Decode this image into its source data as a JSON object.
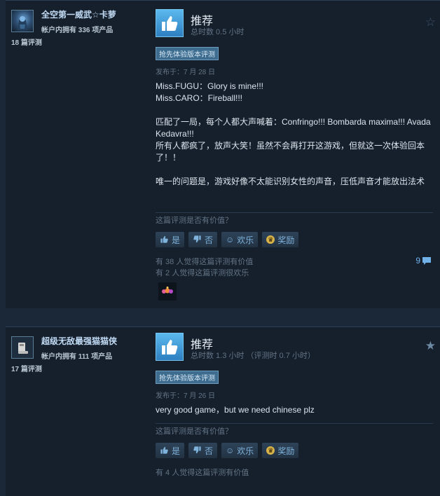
{
  "reviews": [
    {
      "author": {
        "name": "全空第一威武☆卡萝",
        "products": "帐户内拥有 336 项产品",
        "reviews": "18 篇评测"
      },
      "recommendation": "推荐",
      "playtime": "总时数 0.5 小时",
      "early_access_badge": "抢先体验版本评测",
      "posted": "发布于：7 月 28 日",
      "body_lines": [
        "Miss.FUGU：Glory is mine!!!",
        "Miss.CARO：Fireball!!!",
        "",
        "匹配了一局，每个人都大声喊着：Confringo!!! Bombarda maxima!!! Avada Kedavra!!!",
        "所有人都疯了，放声大笑！虽然不会再打开这游戏，但就这一次体验回本了！！",
        "",
        "唯一的问题是，游戏好像不太能识别女性的声音，压低声音才能放出法术"
      ],
      "helpful_question": "这篇评测是否有价值？",
      "buttons": {
        "yes": "是",
        "no": "否",
        "funny": "欢乐",
        "award": "奖励"
      },
      "helpful_count": "有 38 人觉得这篇评测有价值",
      "funny_count": "有 2 人觉得这篇评测很欢乐",
      "comment_count": "9"
    },
    {
      "author": {
        "name": "超级无敌最强猫猫侠",
        "products": "帐户内拥有 111 项产品",
        "reviews": "17 篇评测"
      },
      "recommendation": "推荐",
      "playtime": "总时数 1.3 小时 （评测时 0.7 小时）",
      "early_access_badge": "抢先体验版本评测",
      "posted": "发布于：7 月 26 日",
      "body_lines": [
        "very good game，but we need chinese plz"
      ],
      "helpful_question": "这篇评测是否有价值？",
      "buttons": {
        "yes": "是",
        "no": "否",
        "funny": "欢乐",
        "award": "奖励"
      },
      "helpful_count": "有 4 人觉得这篇评测有价值"
    }
  ],
  "icons": {
    "thumbs_up": "thumbs-up-icon",
    "thumbs_down": "thumbs-down-icon",
    "smile": "smile-icon",
    "award": "award-icon",
    "star": "star-icon",
    "comment": "comment-icon"
  },
  "colors": {
    "page_bg": "#1b2838",
    "card_bg": "#16202d",
    "thumb_blue": "#4ba8e0",
    "link_blue": "#6fb1e8",
    "badge_bg": "#3e6c8f"
  }
}
